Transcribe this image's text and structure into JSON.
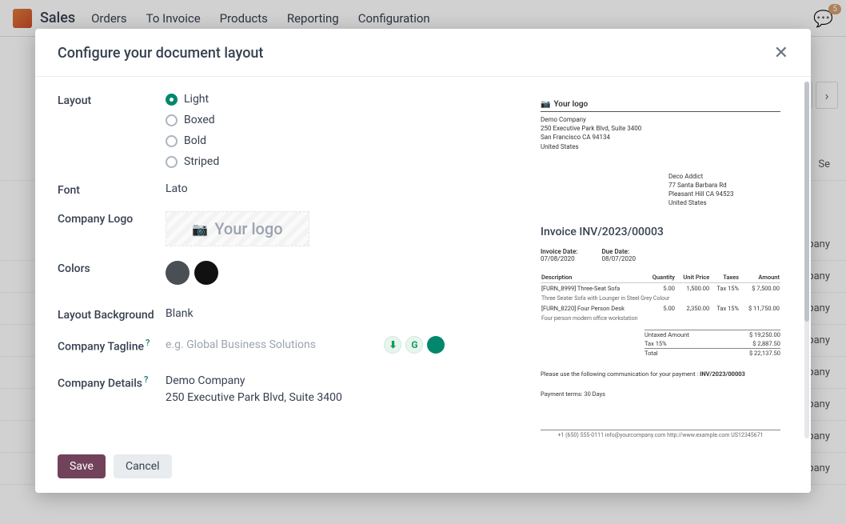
{
  "nav": {
    "app": "Sales",
    "items": [
      "Orders",
      "To Invoice",
      "Products",
      "Reporting",
      "Configuration"
    ],
    "chat_badge": "5"
  },
  "bg": {
    "cell_right": "pany",
    "header_right": "Se"
  },
  "modal": {
    "title": "Configure your document layout",
    "labels": {
      "layout": "Layout",
      "font": "Font",
      "company_logo": "Company Logo",
      "colors": "Colors",
      "layout_bg": "Layout Background",
      "tagline": "Company Tagline",
      "details": "Company Details"
    },
    "layout_options": [
      "Light",
      "Boxed",
      "Bold",
      "Striped"
    ],
    "layout_selected": "Light",
    "font_value": "Lato",
    "logo_text": "Your logo",
    "layout_bg_value": "Blank",
    "tagline_placeholder": "e.g. Global Business Solutions",
    "details_line1": "Demo Company",
    "details_line2": "250 Executive Park Blvd, Suite 3400",
    "save": "Save",
    "cancel": "Cancel"
  },
  "preview": {
    "logo": "Your logo",
    "company": {
      "name": "Demo Company",
      "addr1": "250 Executive Park Blvd, Suite 3400",
      "addr2": "San Francisco CA 94134",
      "country": "United States"
    },
    "customer": {
      "name": "Deco Addict",
      "addr1": "77 Santa Barbara Rd",
      "addr2": "Pleasant Hill CA 94523",
      "country": "United States"
    },
    "doc_title": "Invoice INV/2023/00003",
    "invoice_date_lbl": "Invoice Date:",
    "invoice_date": "07/08/2020",
    "due_date_lbl": "Due Date:",
    "due_date": "08/07/2020",
    "cols": {
      "desc": "Description",
      "qty": "Quantity",
      "unit": "Unit Price",
      "taxes": "Taxes",
      "amount": "Amount"
    },
    "lines": [
      {
        "ref": "[FURN_8999] Three-Seat Sofa",
        "desc": "Three Seater Sofa with Lounger in Steel Grey Colour",
        "qty": "5.00",
        "unit": "1,500.00",
        "tax": "Tax 15%",
        "amt": "$ 7,500.00"
      },
      {
        "ref": "[FURN_8220] Four Person Desk",
        "desc": "Four person modern office workstation",
        "qty": "5.00",
        "unit": "2,350.00",
        "tax": "Tax 15%",
        "amt": "$ 11,750.00"
      }
    ],
    "totals": {
      "untaxed_lbl": "Untaxed Amount",
      "untaxed": "$ 19,250.00",
      "tax_lbl": "Tax 15%",
      "tax": "$ 2,887.50",
      "total_lbl": "Total",
      "total": "$ 22,137.50"
    },
    "comms": "Please use the following communication for your payment :",
    "comms_ref": "INV/2023/00003",
    "terms": "Payment terms: 30 Days",
    "footer": "+1 (650) 555-0111  info@yourcompany.com  http://www.example.com  US12345671"
  },
  "colors": {
    "c1": "#4a4f55",
    "c2": "#111111"
  }
}
